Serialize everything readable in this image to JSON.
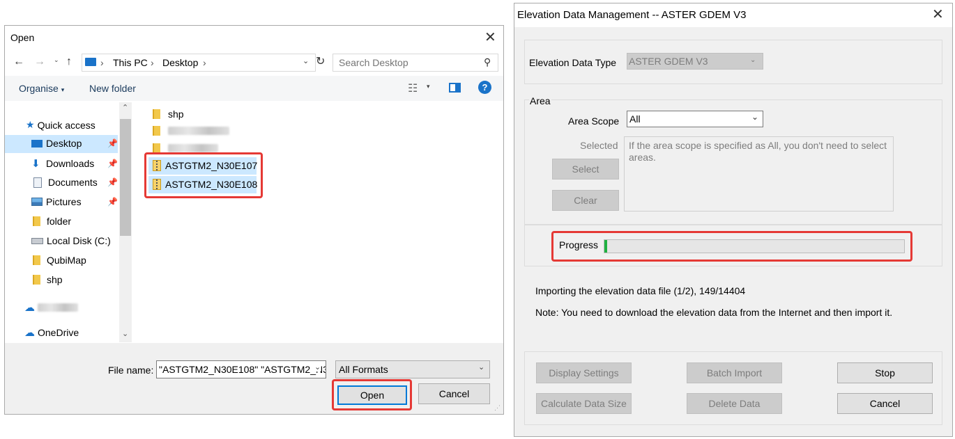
{
  "open_dialog": {
    "title": "Open",
    "address": {
      "segments": [
        "This PC",
        "Desktop"
      ]
    },
    "search": {
      "placeholder": "Search Desktop"
    },
    "toolbar": {
      "organise": "Organise",
      "new_folder": "New folder"
    },
    "nav": {
      "quick_access": "Quick access",
      "items": [
        {
          "label": "Desktop",
          "icon": "desktop-icon",
          "pinned": true,
          "selected": true
        },
        {
          "label": "Downloads",
          "icon": "download-arrow-icon",
          "pinned": true
        },
        {
          "label": "Documents",
          "icon": "document-icon",
          "pinned": true
        },
        {
          "label": "Pictures",
          "icon": "pictures-icon",
          "pinned": true
        },
        {
          "label": "folder",
          "icon": "folder-icon"
        },
        {
          "label": "Local Disk (C:)",
          "icon": "drive-icon"
        },
        {
          "label": "QubiMap",
          "icon": "folder-icon"
        },
        {
          "label": "shp",
          "icon": "folder-icon"
        }
      ],
      "onedrive": "OneDrive"
    },
    "files": [
      {
        "name": "shp",
        "icon": "folder-icon"
      },
      {
        "name": "ASTGTM2_N30E107",
        "icon": "zip-folder-icon",
        "selected": true
      },
      {
        "name": "ASTGTM2_N30E108",
        "icon": "zip-folder-icon",
        "selected": true
      }
    ],
    "footer": {
      "file_name_label": "File name:",
      "file_name_value": "\"ASTGTM2_N30E108\" \"ASTGTM2_N3",
      "filter_value": "All Formats",
      "open_label": "Open",
      "cancel_label": "Cancel"
    }
  },
  "elevation_dialog": {
    "title": "Elevation Data Management -- ASTER GDEM V3",
    "data_type_label": "Elevation Data Type",
    "data_type_value": "ASTER GDEM V3",
    "area_group_label": "Area",
    "area_scope_label": "Area Scope",
    "area_scope_value": "All",
    "selected_label": "Selected",
    "select_button": "Select",
    "clear_button": "Clear",
    "selected_info": "If the area scope is specified as All, you don't need to select areas.",
    "progress_label": "Progress",
    "progress_value": 0.01,
    "status_text": "Importing the elevation data file (1/2), 149/14404",
    "note_text": "Note: You need to download the elevation data from the Internet and then import it.",
    "buttons": {
      "display_settings": "Display Settings",
      "batch_import": "Batch Import",
      "stop": "Stop",
      "calculate_data_size": "Calculate Data Size",
      "delete_data": "Delete Data",
      "cancel": "Cancel"
    }
  },
  "colors": {
    "selection": "#cce8ff",
    "highlight": "#e53935",
    "progress": "#1fb141",
    "help": "#1a73c9"
  }
}
